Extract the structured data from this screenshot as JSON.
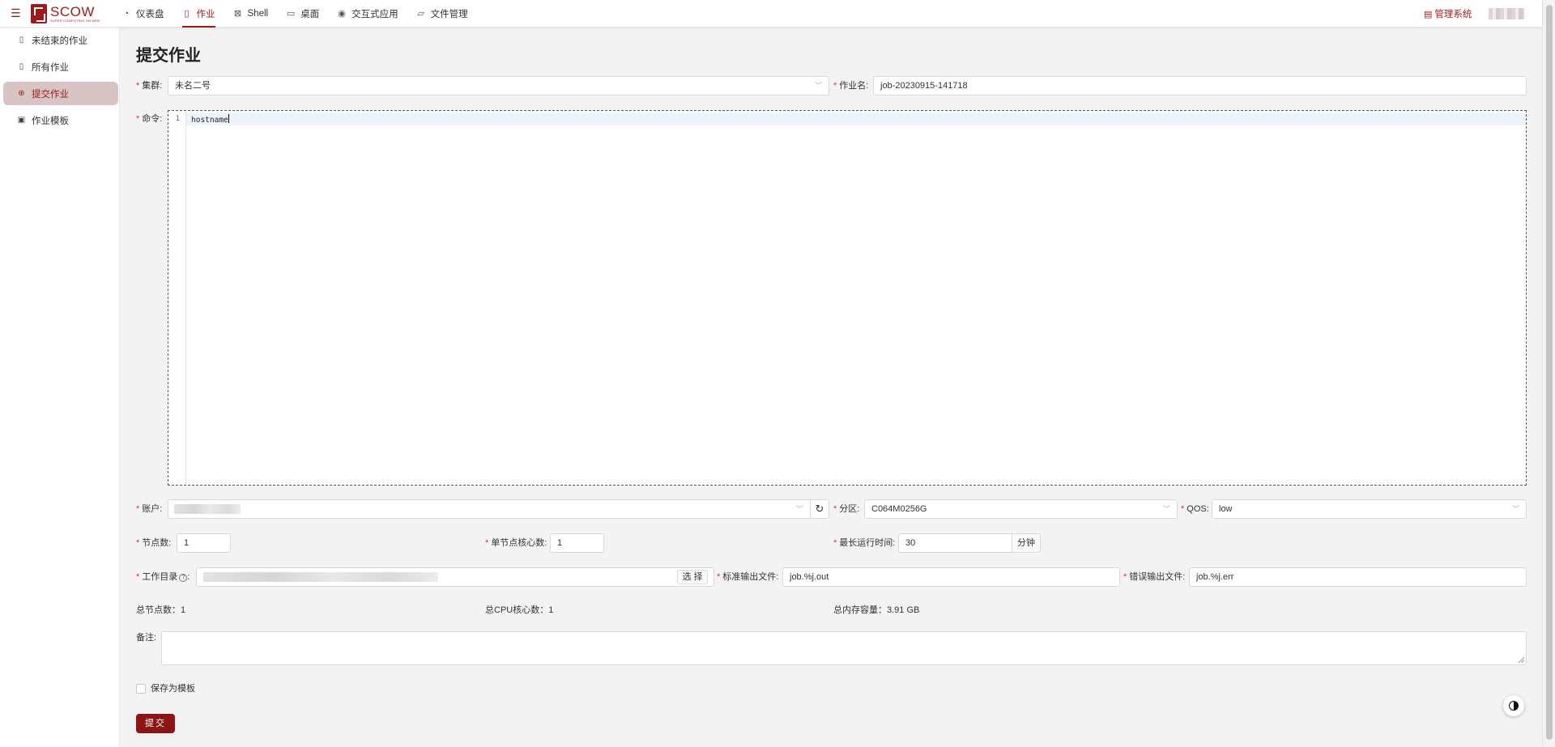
{
  "header": {
    "logo": {
      "title": "SCOW",
      "subtitle": "SUPER COMPUTING ON WEB"
    },
    "nav": [
      {
        "label": "仪表盘",
        "icon": "dashboard-icon"
      },
      {
        "label": "作业",
        "icon": "file-icon",
        "active": true
      },
      {
        "label": "Shell",
        "icon": "terminal-icon"
      },
      {
        "label": "桌面",
        "icon": "desktop-icon"
      },
      {
        "label": "交互式应用",
        "icon": "eye-icon"
      },
      {
        "label": "文件管理",
        "icon": "folder-icon"
      }
    ],
    "admin_label": "管理系统"
  },
  "sidebar": {
    "items": [
      {
        "label": "未结束的作业",
        "icon": "file-icon"
      },
      {
        "label": "所有作业",
        "icon": "file-icon"
      },
      {
        "label": "提交作业",
        "icon": "plus-circle-icon",
        "active": true
      },
      {
        "label": "作业模板",
        "icon": "save-icon"
      }
    ]
  },
  "page_title": "提交作业",
  "form": {
    "cluster": {
      "label": "集群:",
      "value": "未名二号"
    },
    "job_name": {
      "label": "作业名:",
      "value": "job-20230915-141718"
    },
    "command": {
      "label": "命令:",
      "line_number": "1",
      "code": "hostname"
    },
    "account": {
      "label": "账户:"
    },
    "partition": {
      "label": "分区:",
      "value": "C064M0256G"
    },
    "qos": {
      "label": "QOS:",
      "value": "low"
    },
    "nodes": {
      "label": "节点数:",
      "value": "1"
    },
    "cores_per_node": {
      "label": "单节点核心数:",
      "value": "1"
    },
    "max_time": {
      "label": "最长运行时间:",
      "value": "30",
      "unit": "分钟"
    },
    "work_dir": {
      "label": "工作目录",
      "select_label": "选 择"
    },
    "stdout": {
      "label": "标准输出文件:",
      "value": "job.%j.out"
    },
    "stderr": {
      "label": "错误输出文件:",
      "value": "job.%j.err"
    },
    "totals": {
      "nodes": "总节点数：1",
      "cpu_cores": "总CPU核心数：1",
      "memory": "总内存容量：3.91 GB"
    },
    "remark": {
      "label": "备注:"
    },
    "save_template": {
      "label": "保存为模板"
    },
    "submit_label": "提交"
  },
  "colors": {
    "accent": "#9b1b1b",
    "required": "#d9363e",
    "active_bg": "#d9c4c4"
  }
}
